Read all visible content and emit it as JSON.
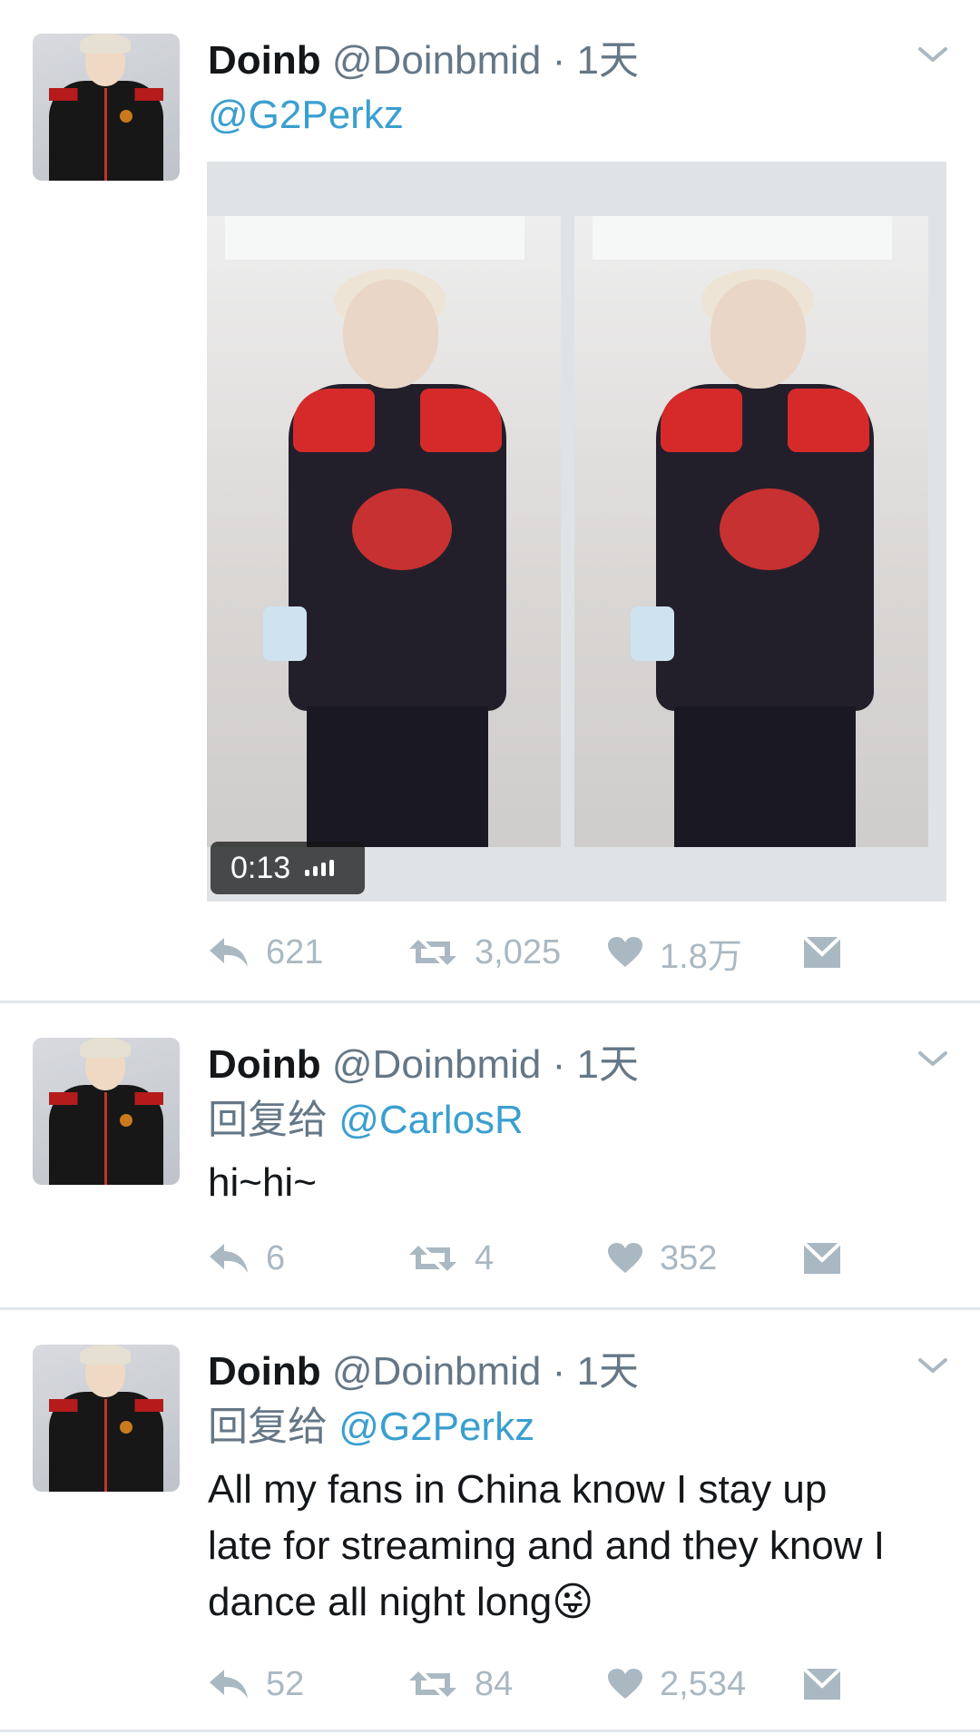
{
  "tweets": [
    {
      "name": "Doinb",
      "handle": "@Doinbmid",
      "time": "· 1天",
      "reply_prefix": "",
      "mention": "@G2Perkz",
      "text": "",
      "video_duration": "0:13",
      "counts": {
        "reply": "621",
        "retweet": "3,025",
        "like": "1.8万"
      }
    },
    {
      "name": "Doinb",
      "handle": "@Doinbmid",
      "time": "· 1天",
      "reply_prefix": "回复给",
      "mention": "@CarlosR",
      "text": "hi~hi~",
      "counts": {
        "reply": "6",
        "retweet": "4",
        "like": "352"
      }
    },
    {
      "name": "Doinb",
      "handle": "@Doinbmid",
      "time": "· 1天",
      "reply_prefix": "回复给",
      "mention": "@G2Perkz",
      "text_lines": [
        "All my fans in China know I stay up",
        "late for streaming and and they know I",
        "dance all night long"
      ],
      "emoji": "😜",
      "counts": {
        "reply": "52",
        "retweet": "84",
        "like": "2,534"
      }
    }
  ],
  "icons": [
    "chevron-down-icon",
    "reply-icon",
    "retweet-icon",
    "like-icon",
    "direct-message-icon",
    "volume-icon"
  ],
  "colors": {
    "mention": "#3a9fcf",
    "action_gray": "#aab8c2",
    "secondary_text": "#657786",
    "divider": "#e1e8ed"
  }
}
